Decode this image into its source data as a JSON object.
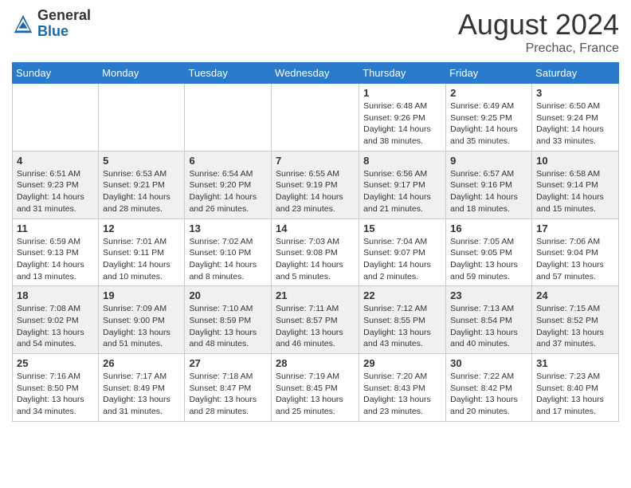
{
  "logo": {
    "general": "General",
    "blue": "Blue"
  },
  "title": "August 2024",
  "subtitle": "Prechac, France",
  "weekdays": [
    "Sunday",
    "Monday",
    "Tuesday",
    "Wednesday",
    "Thursday",
    "Friday",
    "Saturday"
  ],
  "weeks": [
    [
      {
        "day": "",
        "info": ""
      },
      {
        "day": "",
        "info": ""
      },
      {
        "day": "",
        "info": ""
      },
      {
        "day": "",
        "info": ""
      },
      {
        "day": "1",
        "info": "Sunrise: 6:48 AM\nSunset: 9:26 PM\nDaylight: 14 hours\nand 38 minutes."
      },
      {
        "day": "2",
        "info": "Sunrise: 6:49 AM\nSunset: 9:25 PM\nDaylight: 14 hours\nand 35 minutes."
      },
      {
        "day": "3",
        "info": "Sunrise: 6:50 AM\nSunset: 9:24 PM\nDaylight: 14 hours\nand 33 minutes."
      }
    ],
    [
      {
        "day": "4",
        "info": "Sunrise: 6:51 AM\nSunset: 9:23 PM\nDaylight: 14 hours\nand 31 minutes."
      },
      {
        "day": "5",
        "info": "Sunrise: 6:53 AM\nSunset: 9:21 PM\nDaylight: 14 hours\nand 28 minutes."
      },
      {
        "day": "6",
        "info": "Sunrise: 6:54 AM\nSunset: 9:20 PM\nDaylight: 14 hours\nand 26 minutes."
      },
      {
        "day": "7",
        "info": "Sunrise: 6:55 AM\nSunset: 9:19 PM\nDaylight: 14 hours\nand 23 minutes."
      },
      {
        "day": "8",
        "info": "Sunrise: 6:56 AM\nSunset: 9:17 PM\nDaylight: 14 hours\nand 21 minutes."
      },
      {
        "day": "9",
        "info": "Sunrise: 6:57 AM\nSunset: 9:16 PM\nDaylight: 14 hours\nand 18 minutes."
      },
      {
        "day": "10",
        "info": "Sunrise: 6:58 AM\nSunset: 9:14 PM\nDaylight: 14 hours\nand 15 minutes."
      }
    ],
    [
      {
        "day": "11",
        "info": "Sunrise: 6:59 AM\nSunset: 9:13 PM\nDaylight: 14 hours\nand 13 minutes."
      },
      {
        "day": "12",
        "info": "Sunrise: 7:01 AM\nSunset: 9:11 PM\nDaylight: 14 hours\nand 10 minutes."
      },
      {
        "day": "13",
        "info": "Sunrise: 7:02 AM\nSunset: 9:10 PM\nDaylight: 14 hours\nand 8 minutes."
      },
      {
        "day": "14",
        "info": "Sunrise: 7:03 AM\nSunset: 9:08 PM\nDaylight: 14 hours\nand 5 minutes."
      },
      {
        "day": "15",
        "info": "Sunrise: 7:04 AM\nSunset: 9:07 PM\nDaylight: 14 hours\nand 2 minutes."
      },
      {
        "day": "16",
        "info": "Sunrise: 7:05 AM\nSunset: 9:05 PM\nDaylight: 13 hours\nand 59 minutes."
      },
      {
        "day": "17",
        "info": "Sunrise: 7:06 AM\nSunset: 9:04 PM\nDaylight: 13 hours\nand 57 minutes."
      }
    ],
    [
      {
        "day": "18",
        "info": "Sunrise: 7:08 AM\nSunset: 9:02 PM\nDaylight: 13 hours\nand 54 minutes."
      },
      {
        "day": "19",
        "info": "Sunrise: 7:09 AM\nSunset: 9:00 PM\nDaylight: 13 hours\nand 51 minutes."
      },
      {
        "day": "20",
        "info": "Sunrise: 7:10 AM\nSunset: 8:59 PM\nDaylight: 13 hours\nand 48 minutes."
      },
      {
        "day": "21",
        "info": "Sunrise: 7:11 AM\nSunset: 8:57 PM\nDaylight: 13 hours\nand 46 minutes."
      },
      {
        "day": "22",
        "info": "Sunrise: 7:12 AM\nSunset: 8:55 PM\nDaylight: 13 hours\nand 43 minutes."
      },
      {
        "day": "23",
        "info": "Sunrise: 7:13 AM\nSunset: 8:54 PM\nDaylight: 13 hours\nand 40 minutes."
      },
      {
        "day": "24",
        "info": "Sunrise: 7:15 AM\nSunset: 8:52 PM\nDaylight: 13 hours\nand 37 minutes."
      }
    ],
    [
      {
        "day": "25",
        "info": "Sunrise: 7:16 AM\nSunset: 8:50 PM\nDaylight: 13 hours\nand 34 minutes."
      },
      {
        "day": "26",
        "info": "Sunrise: 7:17 AM\nSunset: 8:49 PM\nDaylight: 13 hours\nand 31 minutes."
      },
      {
        "day": "27",
        "info": "Sunrise: 7:18 AM\nSunset: 8:47 PM\nDaylight: 13 hours\nand 28 minutes."
      },
      {
        "day": "28",
        "info": "Sunrise: 7:19 AM\nSunset: 8:45 PM\nDaylight: 13 hours\nand 25 minutes."
      },
      {
        "day": "29",
        "info": "Sunrise: 7:20 AM\nSunset: 8:43 PM\nDaylight: 13 hours\nand 23 minutes."
      },
      {
        "day": "30",
        "info": "Sunrise: 7:22 AM\nSunset: 8:42 PM\nDaylight: 13 hours\nand 20 minutes."
      },
      {
        "day": "31",
        "info": "Sunrise: 7:23 AM\nSunset: 8:40 PM\nDaylight: 13 hours\nand 17 minutes."
      }
    ]
  ]
}
